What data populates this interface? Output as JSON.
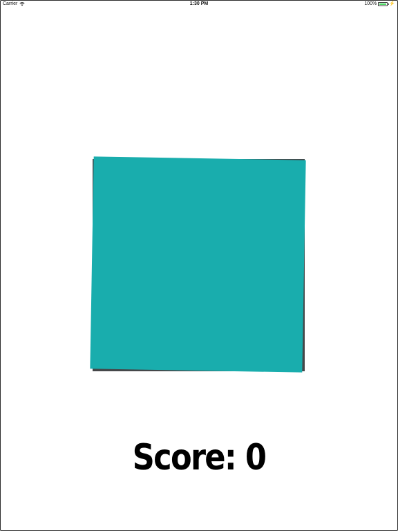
{
  "status_bar": {
    "carrier": "Carrier",
    "time": "1:30 PM",
    "battery": "100%",
    "battery_level": 1.0,
    "battery_color": "#4cd964"
  },
  "game": {
    "square_color": "#19adad",
    "shadow_color": "#454749",
    "score_label": "Score: 0"
  }
}
